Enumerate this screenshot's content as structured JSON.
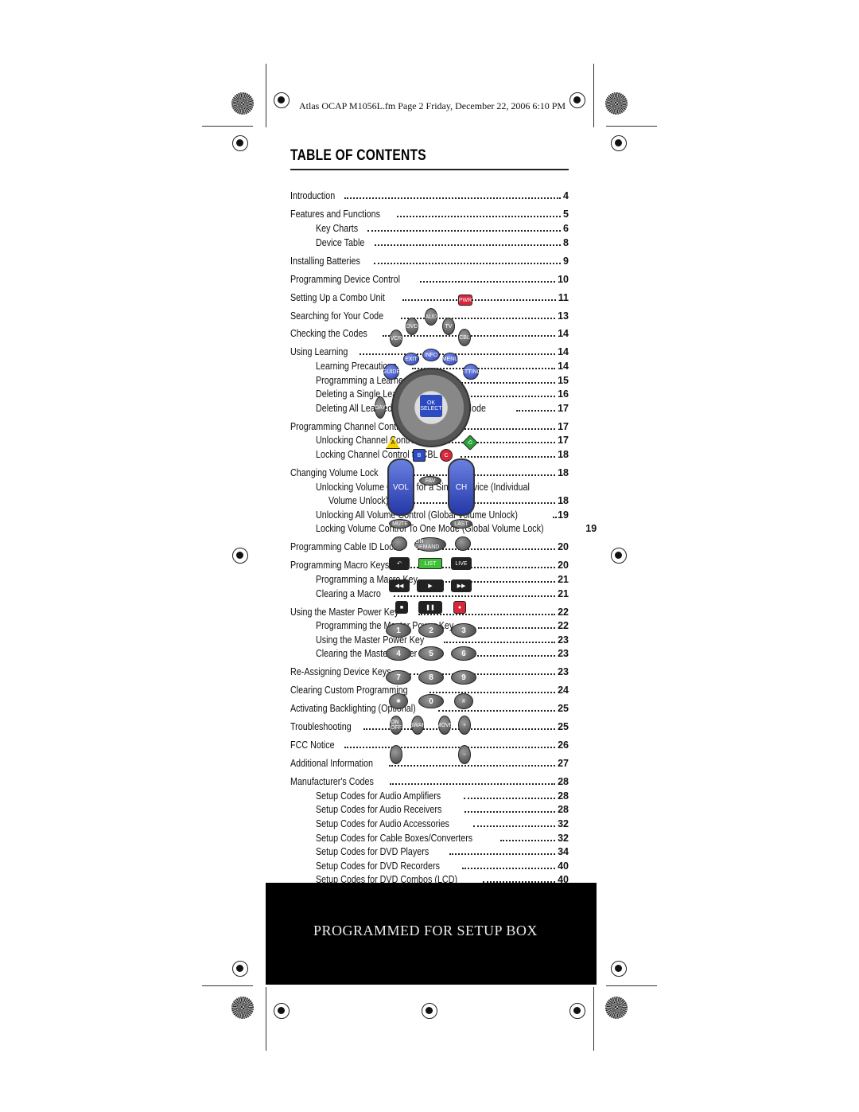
{
  "header": "Atlas OCAP M1056L.fm  Page 2  Friday, December 22, 2006  6:10 PM",
  "title": "TABLE OF CONTENTS",
  "toc": [
    {
      "t": "Introduction",
      "p": "4",
      "l": 1
    },
    {
      "t": "Features and Functions",
      "p": "5",
      "l": 1
    },
    {
      "t": "Key Charts",
      "p": "6",
      "l": 2
    },
    {
      "t": "Device Table",
      "p": "8",
      "l": 2
    },
    {
      "t": "Installing Batteries",
      "p": "9",
      "l": 1
    },
    {
      "t": "Programming Device Control",
      "p": "10",
      "l": 1
    },
    {
      "t": "Setting Up a Combo Unit",
      "p": "11",
      "l": 1
    },
    {
      "t": "Searching for Your Code",
      "p": "13",
      "l": 1
    },
    {
      "t": "Checking the Codes",
      "p": "14",
      "l": 1
    },
    {
      "t": "Using Learning",
      "p": "14",
      "l": 1
    },
    {
      "t": "Learning Precautions",
      "p": "14",
      "l": 2
    },
    {
      "t": "Programming a Learned Key",
      "p": "15",
      "l": 2
    },
    {
      "t": "Deleting a Single Learned Key",
      "p": "16",
      "l": 2
    },
    {
      "t": "Deleting All Learned Keys in a Specific Mode",
      "p": "17",
      "l": 2
    },
    {
      "t": "Programming Channel Control Lock",
      "p": "17",
      "l": 1
    },
    {
      "t": "Unlocking Channel Control",
      "p": "17",
      "l": 2
    },
    {
      "t": "Locking Channel Control to CBL",
      "p": "18",
      "l": 2
    },
    {
      "t": "Changing Volume Lock",
      "p": "18",
      "l": 1
    },
    {
      "t": "Unlocking Volume Control for a Single Device (Individual",
      "p": "",
      "l": 2
    },
    {
      "t": "Volume Unlock)",
      "p": "18",
      "l": 3
    },
    {
      "t": "Unlocking All Volume Control (Global Volume Unlock)",
      "p": "19",
      "l": 2
    },
    {
      "t": "Locking Volume Control To One Mode (Global Volume Lock)",
      "p": "19",
      "l": 2
    },
    {
      "t": "Programming Cable ID Lock",
      "p": "20",
      "l": 1
    },
    {
      "t": "Programming Macro Keys",
      "p": "20",
      "l": 1
    },
    {
      "t": "Programming a Macro Key",
      "p": "21",
      "l": 2
    },
    {
      "t": "Clearing a Macro",
      "p": "21",
      "l": 2
    },
    {
      "t": "Using the Master Power Key",
      "p": "22",
      "l": 1
    },
    {
      "t": "Programming the Master Power Key",
      "p": "22",
      "l": 2
    },
    {
      "t": "Using the Master Power Key",
      "p": "23",
      "l": 2
    },
    {
      "t": "Clearing the Master Power Key",
      "p": "23",
      "l": 2
    },
    {
      "t": "Re-Assigning Device Keys",
      "p": "23",
      "l": 1
    },
    {
      "t": "Clearing Custom Programming",
      "p": "24",
      "l": 1
    },
    {
      "t": "Activating Backlighting (Optional)",
      "p": "25",
      "l": 1
    },
    {
      "t": "Troubleshooting",
      "p": "25",
      "l": 1
    },
    {
      "t": "FCC Notice",
      "p": "26",
      "l": 1
    },
    {
      "t": "Additional Information",
      "p": "27",
      "l": 1
    },
    {
      "t": "Manufacturer's Codes",
      "p": "28",
      "l": 1
    },
    {
      "t": "Setup Codes for Audio Amplifiers",
      "p": "28",
      "l": 2
    },
    {
      "t": "Setup Codes for Audio Receivers",
      "p": "28",
      "l": 2
    },
    {
      "t": "Setup Codes for Audio Accessories",
      "p": "32",
      "l": 2
    },
    {
      "t": "Setup Codes for Cable Boxes/Converters",
      "p": "32",
      "l": 2
    },
    {
      "t": "Setup Codes for DVD Players",
      "p": "34",
      "l": 2
    },
    {
      "t": "Setup Codes for DVD Recorders",
      "p": "40",
      "l": 2
    },
    {
      "t": "Setup Codes for DVD Combos (LCD)",
      "p": "40",
      "l": 2
    }
  ],
  "footer_box": "PROGRAMMED FOR SETUP BOX",
  "remote": {
    "keys": [
      "PWR",
      "AUD",
      "DVD",
      "TV",
      "VCR",
      "CBL",
      "INFO",
      "EXIT",
      "MENU",
      "GUIDE",
      "SETTINGS",
      "DAY",
      "A",
      "D",
      "B",
      "C",
      "FAV",
      "MUTE",
      "LAST",
      "ON DEMAND",
      "",
      "",
      "↶",
      "LIST",
      "LIVE",
      "◀◀",
      "▶",
      "▶▶",
      "■",
      "❚❚",
      "●",
      "1",
      "2",
      "3",
      "4",
      "5",
      "6",
      "7",
      "8",
      "9",
      "✱",
      "0",
      "#",
      "ON OFF",
      "SWAP",
      "MOVE",
      "+",
      "",
      "−"
    ],
    "vol": "VOL",
    "ch": "CH",
    "ok": "OK SELECT"
  }
}
